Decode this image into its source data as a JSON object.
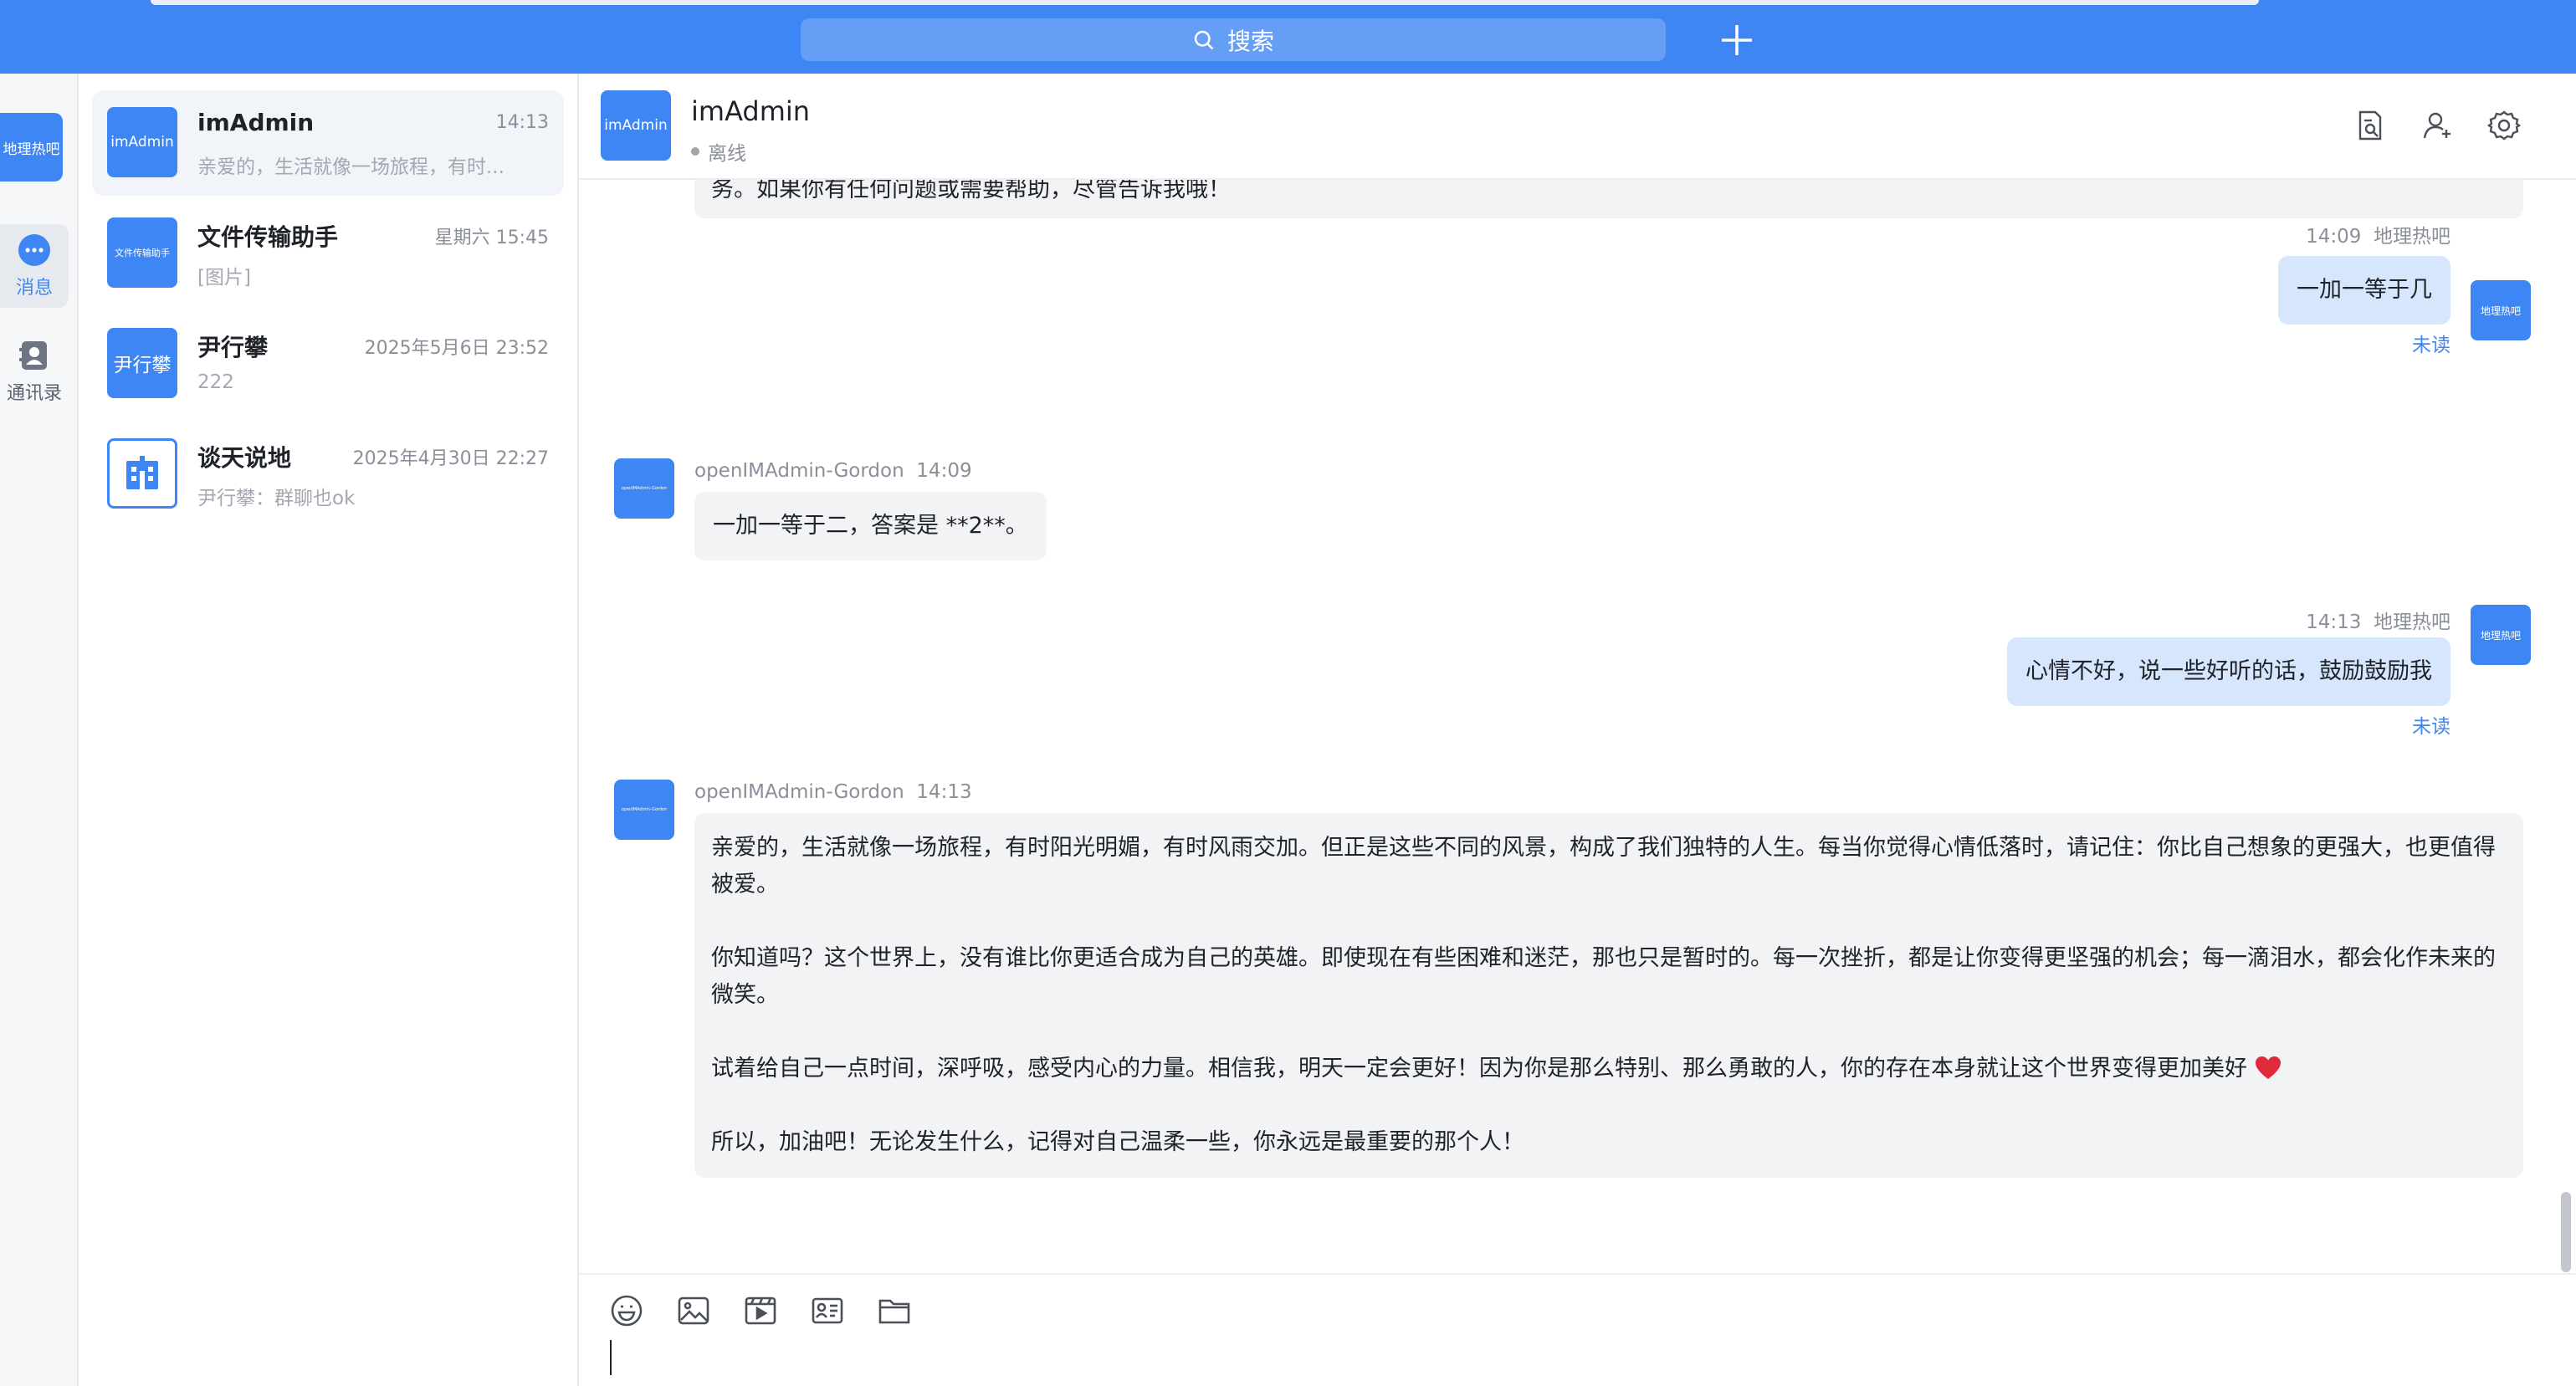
{
  "topbar": {
    "search_placeholder": "搜索"
  },
  "nav": {
    "user_avatar": "地理热吧",
    "items": [
      {
        "label": "消息",
        "icon": "chat-bubble-icon",
        "active": true
      },
      {
        "label": "通讯录",
        "icon": "contacts-icon",
        "active": false
      }
    ]
  },
  "conversations": [
    {
      "avatar": "imAdmin",
      "name": "imAdmin",
      "time": "14:13",
      "preview": "亲爱的，生活就像一场旅程，有时...",
      "active": true
    },
    {
      "avatar": "文件传输助手",
      "name": "文件传输助手",
      "time": "星期六 15:45",
      "preview": "[图片]",
      "active": false
    },
    {
      "avatar": "尹行攀",
      "name": "尹行攀",
      "time": "2025年5月6日 23:52",
      "preview": "222",
      "active": false
    },
    {
      "avatar": "building-icon",
      "name": "谈天说地",
      "time": "2025年4月30日 22:27",
      "preview": "尹行攀：群聊也ok",
      "active": false
    }
  ],
  "chat": {
    "header": {
      "avatar": "imAdmin",
      "name": "imAdmin",
      "status": "离线"
    },
    "messages": [
      {
        "direction": "in",
        "text": "务。如果你有任何问题或需要帮助，尽管告诉我哦！"
      },
      {
        "direction": "out",
        "sender": "地理热吧",
        "time": "14:09",
        "avatar": "地理热吧",
        "text": "一加一等于几",
        "status": "未读"
      },
      {
        "direction": "in",
        "sender": "openIMAdmin-Gordon",
        "time": "14:09",
        "avatar": "openIMAdmin-Gordon",
        "text": "一加一等于二，答案是 **2**。"
      },
      {
        "direction": "out",
        "sender": "地理热吧",
        "time": "14:13",
        "avatar": "地理热吧",
        "text": "心情不好，说一些好听的话，鼓励鼓励我",
        "status": "未读"
      },
      {
        "direction": "in",
        "sender": "openIMAdmin-Gordon",
        "time": "14:13",
        "avatar": "openIMAdmin-Gordon",
        "paragraphs": [
          "亲爱的，生活就像一场旅程，有时阳光明媚，有时风雨交加。但正是这些不同的风景，构成了我们独特的人生。每当你觉得心情低落时，请记住：你比自己想象的更强大，也更值得被爱。",
          "你知道吗？这个世界上，没有谁比你更适合成为自己的英雄。即使现在有些困难和迷茫，那也只是暂时的。每一次挫折，都是让你变得更坚强的机会；每一滴泪水，都会化作未来的微笑。",
          "试着给自己一点时间，深呼吸，感受内心的力量。相信我，明天一定会更好！因为你是那么特别、那么勇敢的人，你的存在本身就让这个世界变得更加美好",
          "所以，加油吧！无论发生什么，记得对自己温柔一些，你永远是最重要的那个人！"
        ]
      }
    ]
  },
  "composer": {
    "tools": [
      "emoji-icon",
      "image-icon",
      "video-icon",
      "card-icon",
      "folder-icon"
    ],
    "input_value": ""
  },
  "colors": {
    "brand": "#3e86f3",
    "in_bubble": "#f2f3f5",
    "out_bubble": "#d5e6fd",
    "heart": "#e02b3c"
  }
}
